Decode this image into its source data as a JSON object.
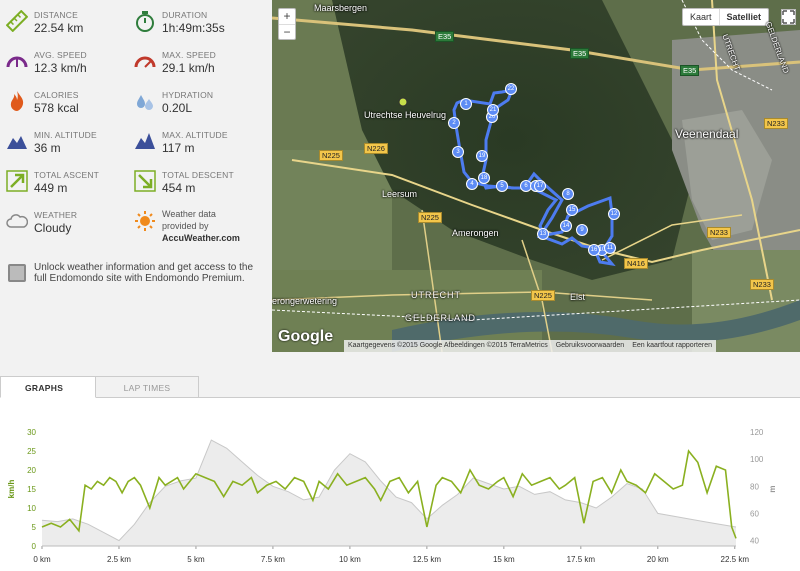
{
  "stats": [
    {
      "label": "DISTANCE",
      "value": "22.54 km",
      "icon": "ruler-icon"
    },
    {
      "label": "DURATION",
      "value": "1h:49m:35s",
      "icon": "stopwatch-icon"
    },
    {
      "label": "AVG. SPEED",
      "value": "12.3 km/h",
      "icon": "speedometer-avg-icon"
    },
    {
      "label": "MAX. SPEED",
      "value": "29.1 km/h",
      "icon": "speedometer-max-icon"
    },
    {
      "label": "CALORIES",
      "value": "578 kcal",
      "icon": "flame-icon"
    },
    {
      "label": "HYDRATION",
      "value": "0.20L",
      "icon": "water-drops-icon"
    },
    {
      "label": "MIN. ALTITUDE",
      "value": "36 m",
      "icon": "mountain-min-icon"
    },
    {
      "label": "MAX. ALTITUDE",
      "value": "117 m",
      "icon": "mountain-max-icon"
    },
    {
      "label": "TOTAL ASCENT",
      "value": "449 m",
      "icon": "ascent-arrow-icon"
    },
    {
      "label": "TOTAL DESCENT",
      "value": "454 m",
      "icon": "descent-arrow-icon"
    },
    {
      "label": "WEATHER",
      "value": "Cloudy",
      "icon": "cloud-icon"
    }
  ],
  "weather_provider": {
    "line1": "Weather data",
    "line2": "provided by",
    "brand": "AccuWeather.com"
  },
  "promo": {
    "text": "Unlock weather information and get access to the full Endomondo site with Endomondo Premium."
  },
  "map": {
    "zoom_in": "+",
    "zoom_out": "−",
    "type_map": "Kaart",
    "type_sat": "Satelliet",
    "google": "Google",
    "copyright": "Kaartgegevens ©2015 Google Afbeeldingen ©2015 TerraMetrics",
    "terms": "Gebruiksvoorwaarden",
    "report": "Een kaartfout rapporteren",
    "places": {
      "maarsbergen": "Maarsbergen",
      "heuvelrug": "Utrechtse Heuvelrug",
      "leersum": "Leersum",
      "amerongen": "Amerongen",
      "veenendaal": "Veenendaal",
      "elst": "Elst",
      "wetering": "erongerwetering",
      "utrecht_river": "UTRECHT",
      "gelderland": "GELDERLAND",
      "utrecht_ne": "UTRECHT",
      "gelderland_ne": "GELDERLAND"
    },
    "roads": {
      "e35a": "E35",
      "e35b": "E35",
      "e35c": "E35",
      "n226": "N226",
      "n225a": "N225",
      "n225b": "N225",
      "n225c": "N225",
      "n233a": "N233",
      "n233b": "N233",
      "n233c": "N233",
      "n416": "N416"
    },
    "markers": [
      "1",
      "2",
      "3",
      "4",
      "5",
      "6",
      "7",
      "8",
      "9",
      "10",
      "11",
      "12",
      "13",
      "14",
      "15",
      "16",
      "17",
      "18",
      "19",
      "20",
      "21",
      "22"
    ]
  },
  "tabs": {
    "graphs": "GRAPHS",
    "laps": "LAP TIMES"
  },
  "colors": {
    "speed": "#8ab020",
    "altitude": "#c8c8c8",
    "route": "#4d7cf0"
  },
  "chart_data": {
    "type": "line",
    "xlabel": "",
    "x_ticks": [
      "0 km",
      "2.5 km",
      "5 km",
      "7.5 km",
      "10 km",
      "12.5 km",
      "15 km",
      "17.5 km",
      "20 km",
      "22.5 km"
    ],
    "y_left_label": "km/h",
    "y_left_ticks": [
      "0",
      "5",
      "10",
      "15",
      "20",
      "25",
      "30"
    ],
    "y_left_lim": [
      0,
      30
    ],
    "y_right_label": "m",
    "y_right_ticks": [
      "40",
      "60",
      "80",
      "100",
      "120"
    ],
    "y_right_lim": [
      36,
      120
    ],
    "series": [
      {
        "name": "Speed",
        "axis": "left",
        "color": "#8ab020",
        "x": [
          0,
          0.3,
          0.6,
          0.9,
          1.2,
          1.3,
          1.4,
          1.6,
          1.8,
          2.0,
          2.2,
          2.4,
          2.6,
          2.8,
          3.0,
          3.2,
          3.5,
          3.8,
          4.0,
          4.2,
          4.4,
          4.6,
          4.8,
          5.0,
          5.3,
          5.6,
          5.9,
          6.2,
          6.5,
          6.8,
          7.0,
          7.3,
          7.6,
          7.9,
          8.2,
          8.5,
          8.8,
          9.0,
          9.3,
          9.6,
          9.9,
          10.2,
          10.5,
          10.8,
          11.0,
          11.3,
          11.6,
          11.9,
          12.2,
          12.5,
          12.8,
          13.0,
          13.3,
          13.6,
          13.9,
          14.2,
          14.5,
          14.8,
          15.0,
          15.3,
          15.6,
          15.9,
          16.2,
          16.5,
          16.8,
          17.0,
          17.3,
          17.6,
          17.9,
          18.2,
          18.5,
          18.8,
          19.0,
          19.3,
          19.6,
          19.9,
          20.2,
          20.5,
          20.8,
          21.0,
          21.3,
          21.6,
          21.9,
          22.2,
          22.4,
          22.54
        ],
        "values": [
          5,
          6,
          5,
          7,
          4,
          10,
          16,
          15,
          17,
          16,
          18,
          17,
          14,
          17,
          18,
          16,
          10,
          18,
          16,
          17,
          18,
          15,
          17,
          19,
          18,
          17,
          13,
          17,
          16,
          18,
          14,
          16,
          17,
          15,
          18,
          17,
          12,
          17,
          15,
          19,
          16,
          17,
          18,
          15,
          12,
          17,
          18,
          14,
          17,
          5,
          16,
          18,
          17,
          14,
          20,
          16,
          15,
          17,
          18,
          13,
          19,
          16,
          17,
          18,
          15,
          16,
          18,
          6,
          17,
          18,
          14,
          20,
          17,
          16,
          14,
          19,
          17,
          15,
          16,
          25,
          22,
          14,
          21,
          20,
          5,
          2
        ]
      },
      {
        "name": "Altitude",
        "axis": "right",
        "color": "#c8c8c8",
        "x": [
          0,
          0.5,
          1.0,
          1.5,
          2.0,
          2.5,
          3.0,
          3.5,
          4.0,
          4.5,
          5.0,
          5.5,
          6.0,
          6.5,
          7.0,
          7.5,
          8.0,
          8.5,
          9.0,
          9.5,
          10.0,
          10.5,
          11.0,
          11.5,
          12.0,
          12.5,
          13.0,
          13.5,
          14.0,
          14.5,
          15.0,
          15.5,
          16.0,
          16.5,
          17.0,
          17.5,
          18.0,
          18.5,
          19.0,
          19.5,
          20.0,
          20.5,
          21.0,
          21.5,
          22.0,
          22.54
        ],
        "values": [
          55,
          54,
          56,
          52,
          46,
          40,
          52,
          68,
          80,
          84,
          86,
          114,
          108,
          98,
          88,
          80,
          76,
          70,
          72,
          92,
          104,
          98,
          84,
          72,
          68,
          56,
          66,
          74,
          86,
          82,
          78,
          80,
          74,
          76,
          70,
          68,
          64,
          72,
          82,
          78,
          60,
          58,
          56,
          54,
          52,
          50
        ]
      }
    ]
  }
}
